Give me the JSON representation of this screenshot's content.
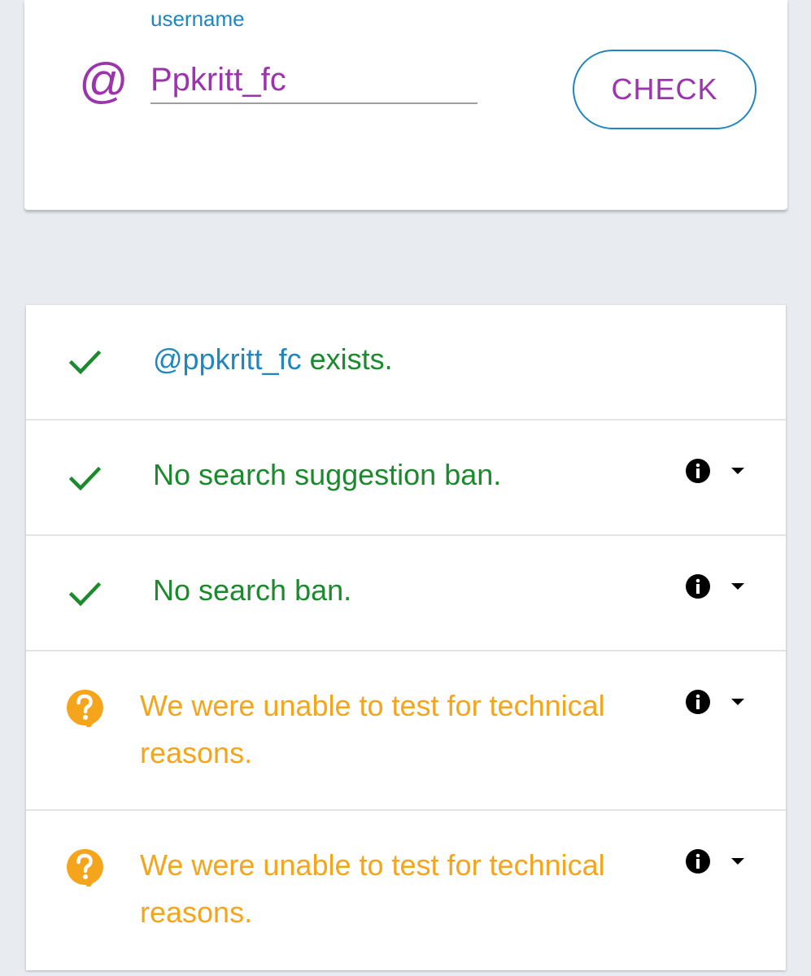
{
  "search": {
    "label": "username",
    "at_symbol": "@",
    "value": "Ppkritt_fc",
    "check_label": "CHECK"
  },
  "results": {
    "exists": {
      "icon": "check-icon",
      "username": "@ppkritt_fc",
      "text": " exists."
    },
    "suggestion_ban": {
      "icon": "check-icon",
      "text": "No search suggestion ban."
    },
    "search_ban": {
      "icon": "check-icon",
      "text": "No search ban."
    },
    "test_3": {
      "icon": "question-icon",
      "text": "We were unable to test for technical reasons."
    },
    "test_4": {
      "icon": "question-icon",
      "text": "We were unable to test for technical reasons."
    }
  },
  "colors": {
    "accent_blue": "#1f87bd",
    "accent_purple": "#9b34ad",
    "success_green": "#1b8a2c",
    "warning_orange": "#f5a51c",
    "background": "#e8ecf1"
  }
}
